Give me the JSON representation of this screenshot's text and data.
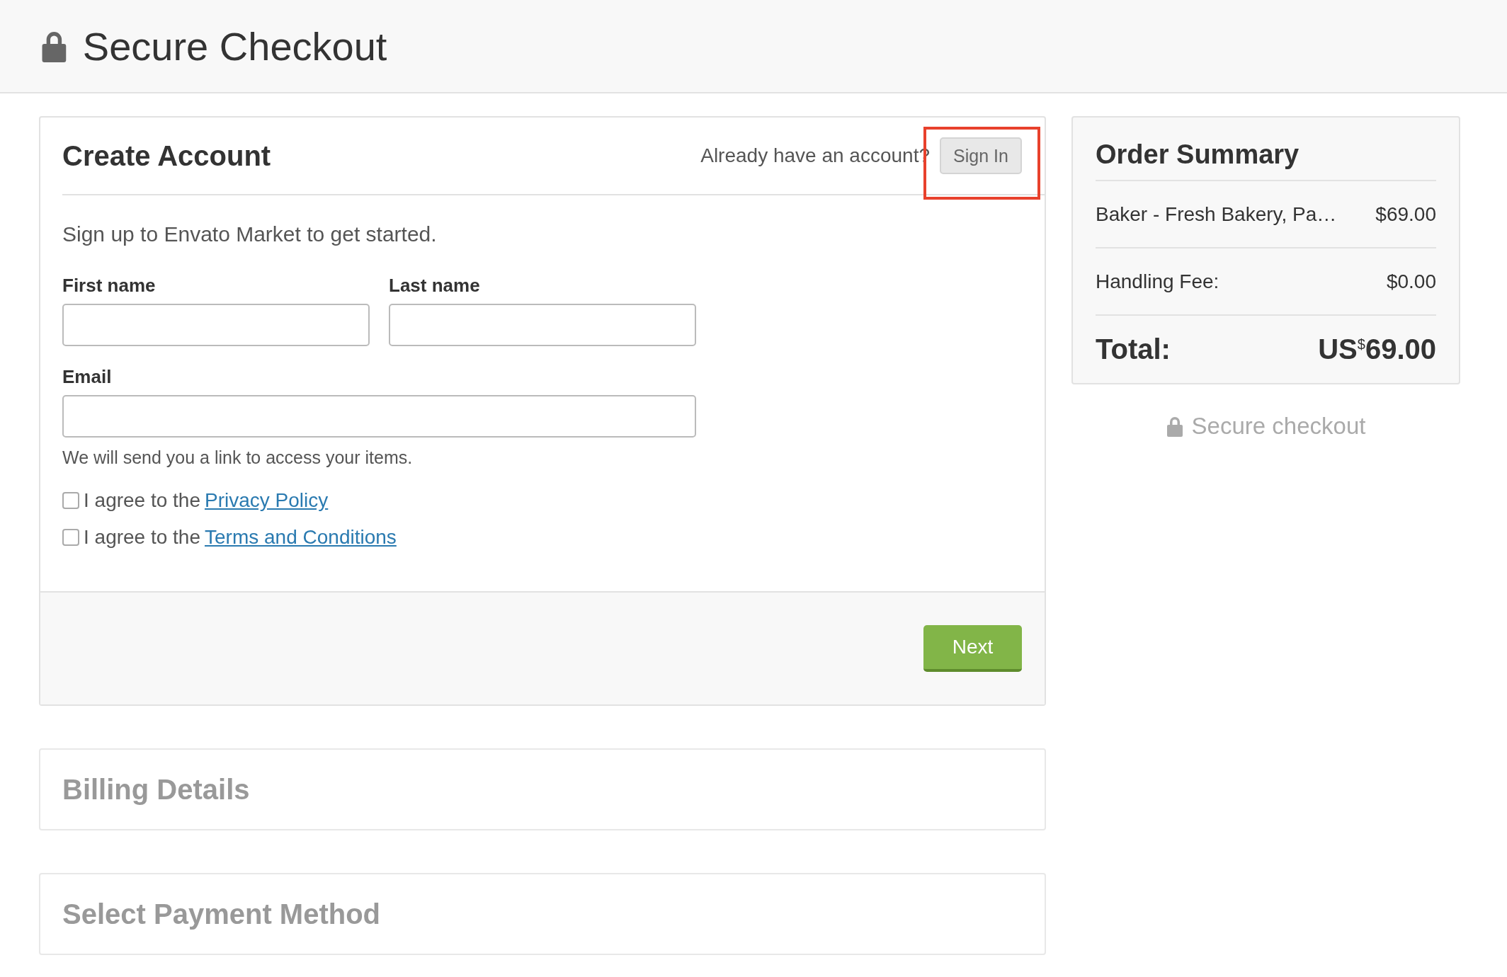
{
  "header": {
    "title": "Secure Checkout"
  },
  "account": {
    "title": "Create Account",
    "signin_prompt": "Already have an account?",
    "signin_button": "Sign In",
    "highlighted": true,
    "intro": "Sign up to Envato Market to get started.",
    "fields": [
      {
        "label": "First name",
        "kind": "half"
      },
      {
        "label": "Last name",
        "kind": "half"
      },
      {
        "label": "Email",
        "kind": "full"
      }
    ],
    "hint": "We will send you a link to access your items.",
    "agreements": [
      {
        "prefix": "I agree to the",
        "link": "Privacy Policy",
        "checked": false
      },
      {
        "prefix": "I agree to the",
        "link": "Terms and Conditions",
        "checked": false
      }
    ],
    "next_button": "Next"
  },
  "collapsed_sections": [
    {
      "title": "Billing Details"
    },
    {
      "title": "Select Payment Method"
    }
  ],
  "summary": {
    "title": "Order Summary",
    "lines": [
      {
        "label": "Baker - Fresh Bakery, Pa…",
        "amount": "$69.00"
      },
      {
        "label": "Handling Fee:",
        "amount": "$0.00"
      }
    ],
    "total_label": "Total:",
    "total_prefix": "US",
    "total_symbol": "$",
    "total_amount": "69.00",
    "secure_note": "Secure checkout"
  }
}
